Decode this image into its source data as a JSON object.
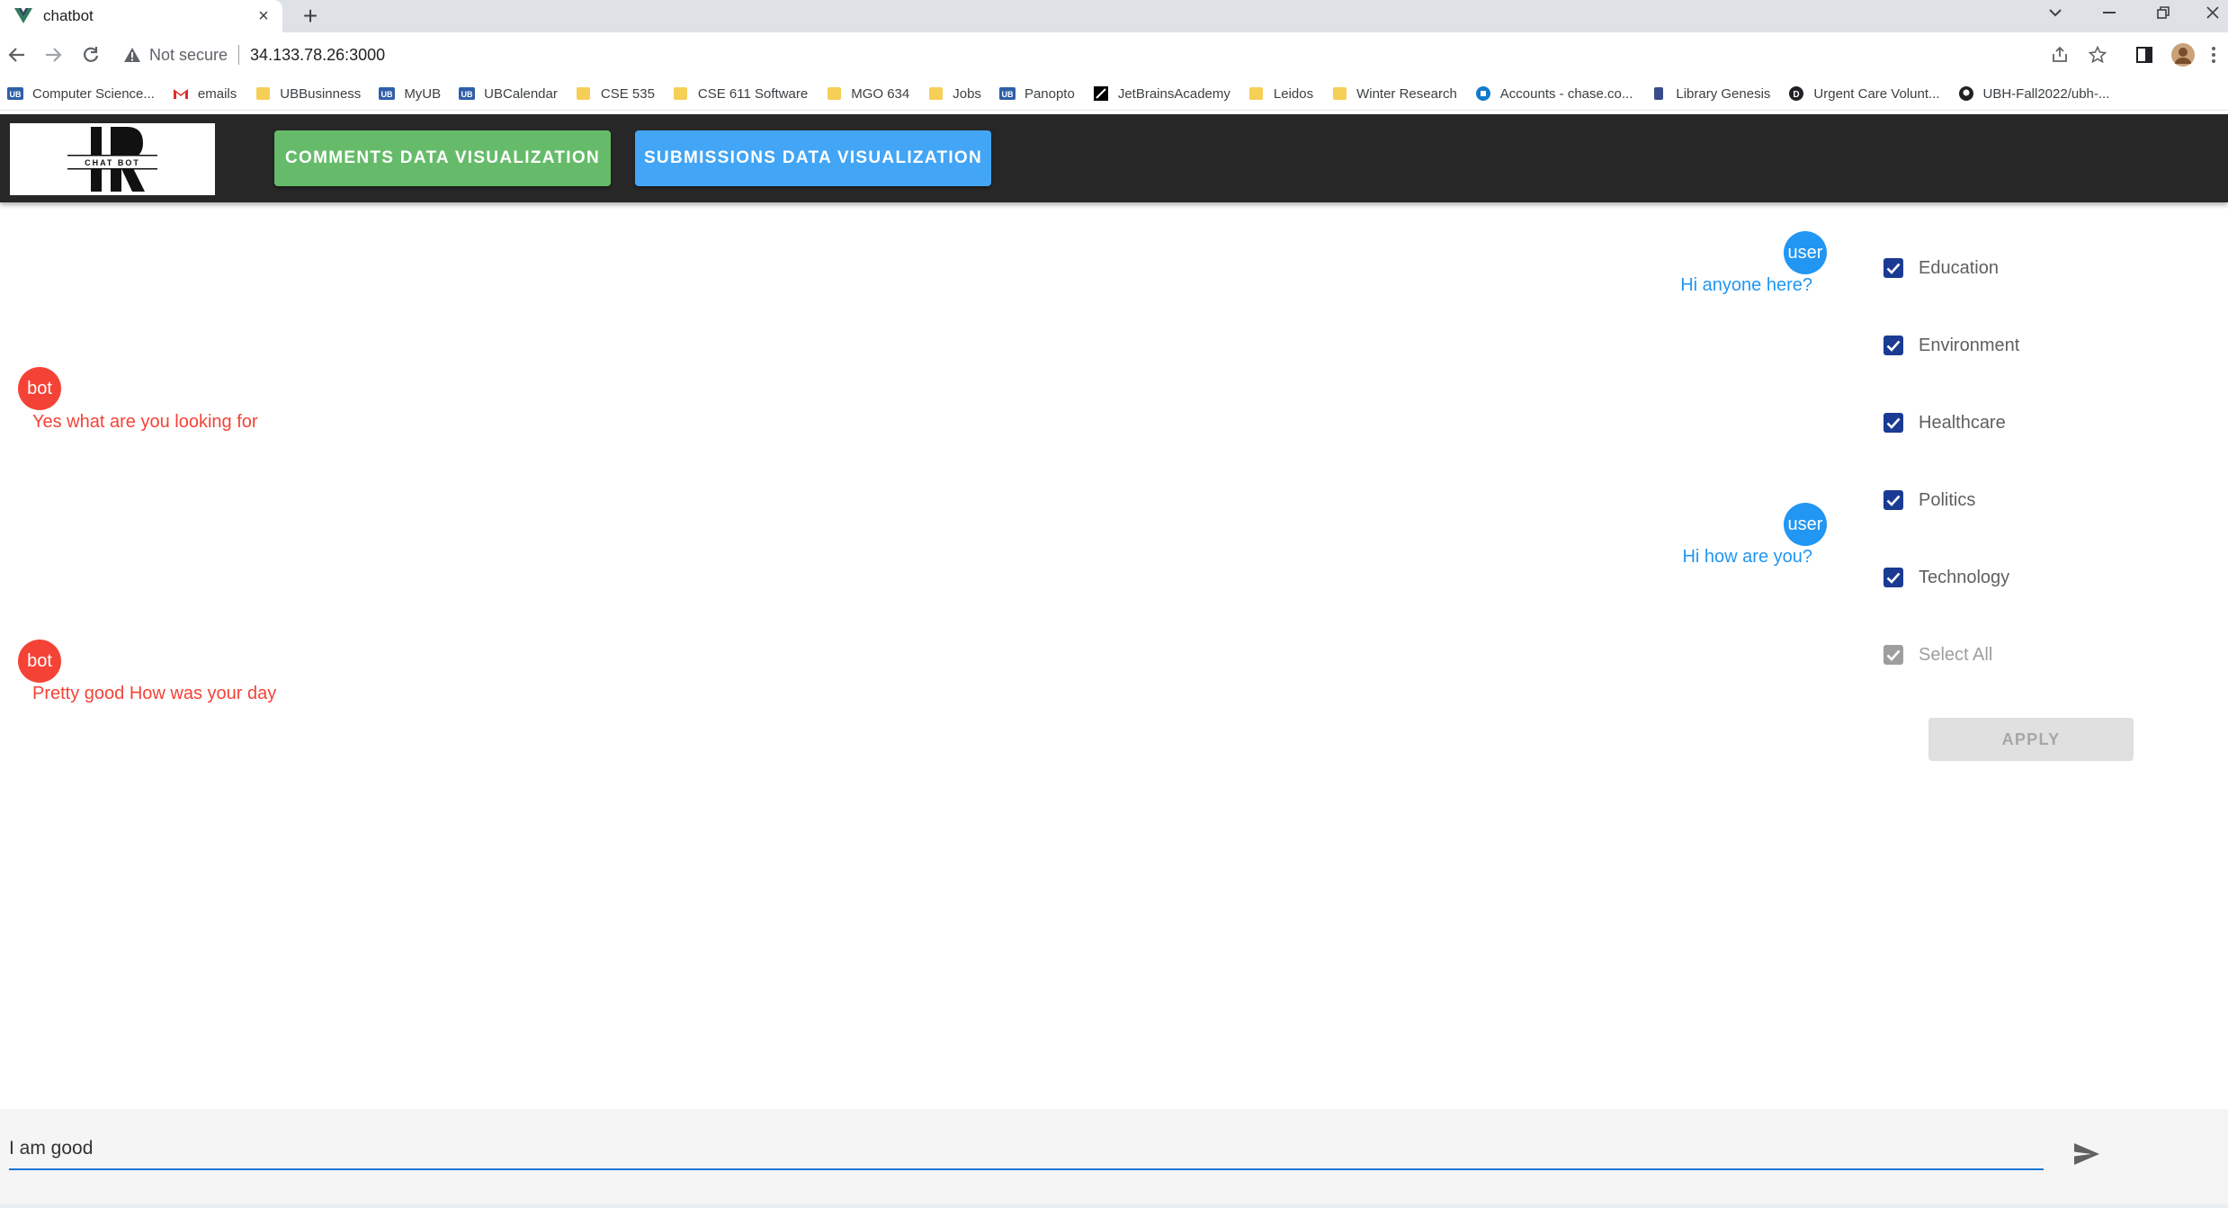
{
  "browser": {
    "tab_title": "chatbot",
    "new_tab_symbol": "+",
    "close_symbol": "×",
    "not_secure": "Not secure",
    "url": "34.133.78.26:3000",
    "bookmarks": [
      {
        "label": "Computer Science...",
        "icon": "ub-icon"
      },
      {
        "label": "emails",
        "icon": "gmail-icon"
      },
      {
        "label": "UBBusinness",
        "icon": "folder-icon"
      },
      {
        "label": "MyUB",
        "icon": "ub-icon"
      },
      {
        "label": "UBCalendar",
        "icon": "ub-icon"
      },
      {
        "label": "CSE 535",
        "icon": "folder-icon"
      },
      {
        "label": "CSE 611 Software",
        "icon": "folder-icon"
      },
      {
        "label": "MGO 634",
        "icon": "folder-icon"
      },
      {
        "label": "Jobs",
        "icon": "folder-icon"
      },
      {
        "label": "Panopto",
        "icon": "ub-icon"
      },
      {
        "label": "JetBrainsAcademy",
        "icon": "jetbrains-icon"
      },
      {
        "label": "Leidos",
        "icon": "folder-icon"
      },
      {
        "label": "Winter Research",
        "icon": "folder-icon"
      },
      {
        "label": "Accounts - chase.co...",
        "icon": "chase-icon"
      },
      {
        "label": "Library Genesis",
        "icon": "library-icon"
      },
      {
        "label": "Urgent Care Volunt...",
        "icon": "d-icon"
      },
      {
        "label": "UBH-Fall2022/ubh-...",
        "icon": "github-icon"
      }
    ]
  },
  "app": {
    "logo_text": "CHAT BOT",
    "nav": {
      "comments": "COMMENTS DATA VISUALIZATION",
      "submissions": "SUBMISSIONS DATA VISUALIZATION"
    },
    "messages": [
      {
        "sender": "user",
        "avatar": "user",
        "text": "Hi anyone here?"
      },
      {
        "sender": "bot",
        "avatar": "bot",
        "text": "Yes what are you looking for"
      },
      {
        "sender": "user",
        "avatar": "user",
        "text": "Hi how are you?"
      },
      {
        "sender": "bot",
        "avatar": "bot",
        "text": "Pretty good How was your day"
      }
    ],
    "filters": [
      {
        "label": "Education",
        "checked": true
      },
      {
        "label": "Environment",
        "checked": true
      },
      {
        "label": "Healthcare",
        "checked": true
      },
      {
        "label": "Politics",
        "checked": true
      },
      {
        "label": "Technology",
        "checked": true
      },
      {
        "label": "Select All",
        "checked": true,
        "disabled": true
      }
    ],
    "apply_label": "APPLY",
    "input_value": "I am good"
  },
  "colors": {
    "appbar": "#272727",
    "comments_button": "#66bb6a",
    "submissions_button": "#42a5f5",
    "user": "#2196f3",
    "bot": "#f44336",
    "checkbox": "#1a3a93"
  }
}
